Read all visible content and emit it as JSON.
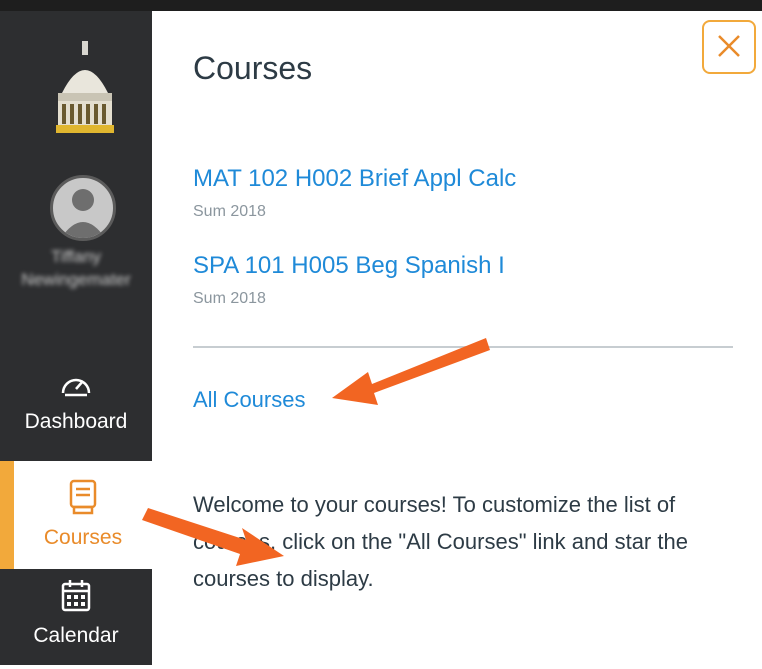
{
  "sidebar": {
    "user_name": "Tiffany Newingemater",
    "items": [
      {
        "label": "Dashboard"
      },
      {
        "label": "Courses"
      },
      {
        "label": "Calendar"
      }
    ]
  },
  "tray": {
    "title": "Courses",
    "courses": [
      {
        "name": "MAT 102 H002 Brief Appl Calc",
        "term": "Sum 2018"
      },
      {
        "name": "SPA 101 H005 Beg Spanish I",
        "term": "Sum 2018"
      }
    ],
    "all_courses_label": "All Courses",
    "welcome_text": "Welcome to your courses! To customize the list of courses, click on the \"All Courses\" link and star the courses to display."
  },
  "colors": {
    "sidebar_bg": "#2d2e30",
    "accent": "#f2a93b",
    "link": "#1f8ad8",
    "annotation_arrow": "#f26522"
  },
  "icons": [
    "logo-dome-icon",
    "avatar-icon",
    "dashboard-icon",
    "courses-icon",
    "calendar-icon",
    "close-icon"
  ]
}
